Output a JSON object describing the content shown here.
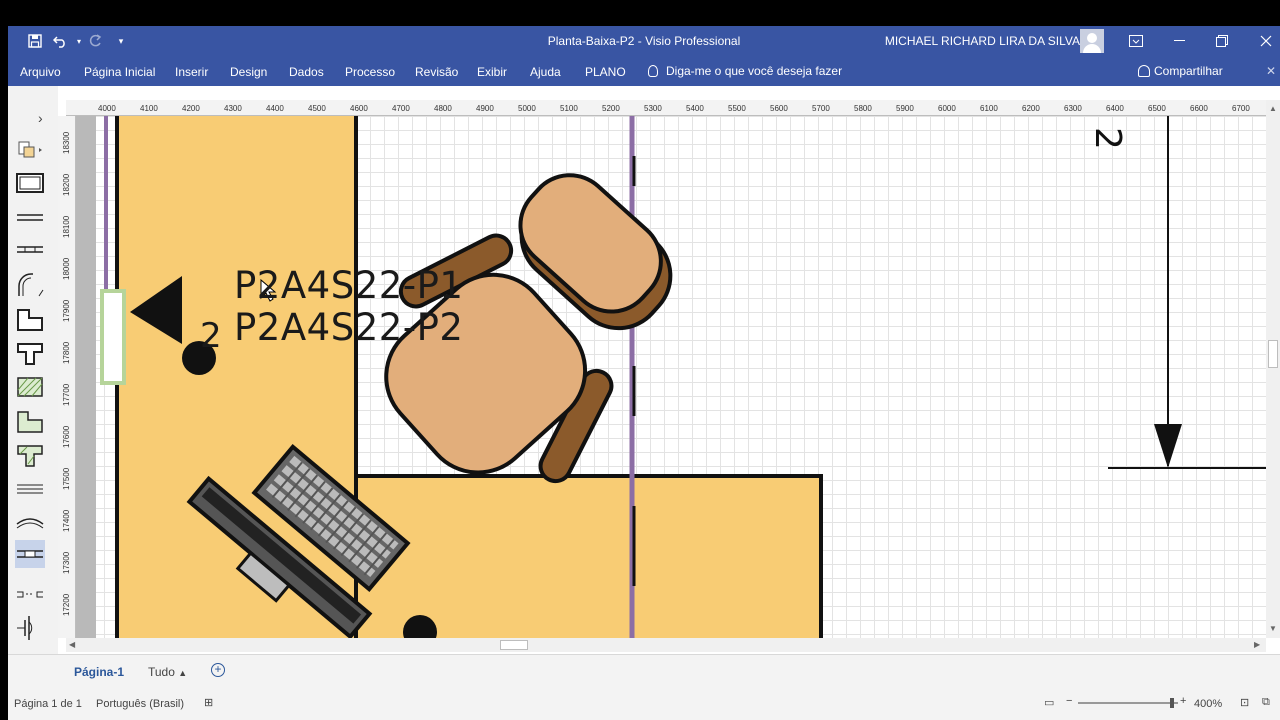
{
  "titlebar": {
    "doc_title": "Planta-Baixa-P2  -  Visio Professional",
    "user_name": "MICHAEL RICHARD LIRA DA SILVA",
    "save_icon": "save-icon",
    "undo_icon": "undo-icon",
    "redo_icon": "redo-icon",
    "customize_icon": "customize-qat-icon"
  },
  "tabs": [
    "Arquivo",
    "Página Inicial",
    "Inserir",
    "Design",
    "Dados",
    "Processo",
    "Revisão",
    "Exibir",
    "Ajuda",
    "PLANO"
  ],
  "tell_me": "Diga-me o que você deseja fazer",
  "share": "Compartilhar",
  "ruler": {
    "h_ticks": [
      "4000",
      "4100",
      "4200",
      "4300",
      "4400",
      "4500",
      "4600",
      "4700",
      "4800",
      "4900",
      "5000",
      "5100",
      "5200",
      "5300",
      "5400",
      "5500",
      "5600",
      "5700",
      "5800",
      "5900",
      "6000",
      "6100",
      "6200",
      "6300",
      "6400",
      "6500",
      "6600",
      "6700"
    ],
    "v_ticks": [
      "18300",
      "18200",
      "18100",
      "18000",
      "17900",
      "17800",
      "17700",
      "17600",
      "17500",
      "17400",
      "17300",
      "17200"
    ]
  },
  "drawing": {
    "label_1": "P2A4S22-P1",
    "label_2": "P2A4S22-P2",
    "wall_number": "2",
    "dimension_label": "2"
  },
  "page_tabs": {
    "page_1": "Página-1",
    "all": "Tudo"
  },
  "status": {
    "page": "Página 1 de 1",
    "language": "Português (Brasil)",
    "zoom": "400%"
  },
  "colors": {
    "accent": "#3955a3",
    "room_fill": "#f8cc74",
    "wall_purple": "#8c6ea5",
    "chair_seat": "#e2ae7b",
    "chair_arm": "#8b5a2b"
  }
}
